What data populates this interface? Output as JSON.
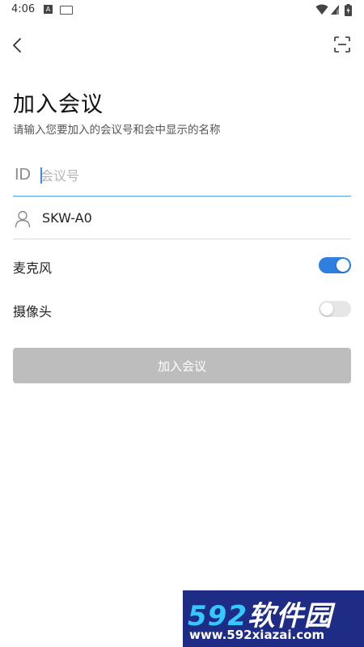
{
  "status_bar": {
    "time": "4:06",
    "notification_a": "A",
    "icons": [
      "a-notification-icon",
      "keyboard-icon",
      "wifi-icon",
      "signal-icon",
      "battery-icon"
    ]
  },
  "colors": {
    "accent": "#2f7fe0",
    "input_underline_active": "#4aa3ea",
    "button_disabled": "#bdbdbd",
    "switch_off": "#e6e6e6"
  },
  "header": {
    "title": "加入会议",
    "subtitle": "请输入您要加入的会议号和会中显示的名称"
  },
  "form": {
    "meeting_id": {
      "prefix": "ID",
      "placeholder": "会议号",
      "value": ""
    },
    "display_name": {
      "icon": "person-icon",
      "value": "SKW-A0"
    }
  },
  "toggles": {
    "microphone": {
      "label": "麦克风",
      "on": true
    },
    "camera": {
      "label": "摄像头",
      "on": false
    }
  },
  "join_button": {
    "label": "加入会议",
    "enabled": false
  },
  "watermark": {
    "number": "592",
    "chinese": "软件园",
    "url": "www.592xiazai.com"
  }
}
